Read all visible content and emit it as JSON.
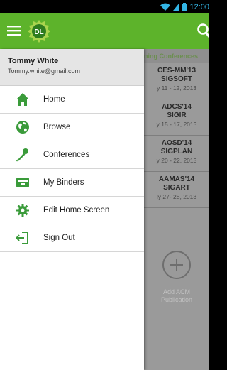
{
  "status_bar": {
    "clock": "12:00"
  },
  "drawer": {
    "user_name": "Tommy White",
    "user_email": "Tommy.white@gmail.com",
    "items": [
      {
        "label": "Home",
        "icon": "home-icon"
      },
      {
        "label": "Browse",
        "icon": "globe-icon"
      },
      {
        "label": "Conferences",
        "icon": "microphone-icon"
      },
      {
        "label": "My Binders",
        "icon": "binder-icon"
      },
      {
        "label": "Edit Home Screen",
        "icon": "gear-icon"
      },
      {
        "label": "Sign Out",
        "icon": "sign-out-icon"
      }
    ]
  },
  "content": {
    "header": "ning Conferences",
    "cards": [
      {
        "title": "CES-MM'13",
        "sig": "SIGSOFT",
        "dates": "y 11 - 12, 2013"
      },
      {
        "title": "ADCS'14",
        "sig": "SIGIR",
        "dates": "y 15 - 17, 2013"
      },
      {
        "title": "AOSD'14",
        "sig": "SIGPLAN",
        "dates": "y 20 - 22, 2013"
      },
      {
        "title": "AAMAS'14",
        "sig": "SIGART",
        "dates": "ly 27- 28, 2013"
      }
    ],
    "add_label_line1": "Add ACM",
    "add_label_line2": "Publication"
  },
  "colors": {
    "accent": "#5db32b",
    "icon_green": "#3a9b3a",
    "clock_blue": "#33b5e5"
  }
}
